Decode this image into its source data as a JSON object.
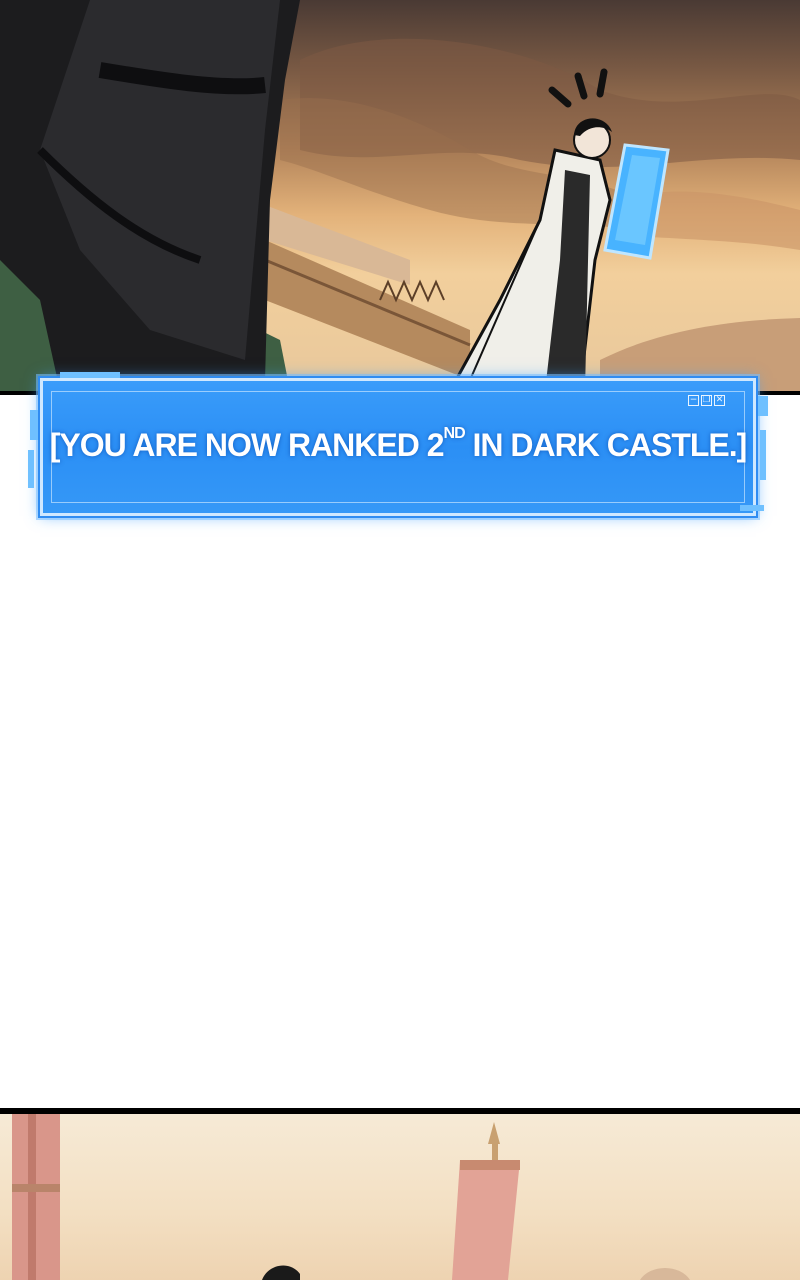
{
  "panels": {
    "top": {
      "description_icon": "sunset-scene-icon"
    },
    "bottom": {
      "description_icon": "banner-scene-icon"
    }
  },
  "system_message": {
    "prefix": "[YOU ARE NOW RANKED 2",
    "superscript": "ND",
    "suffix": " IN DARK CASTLE.]",
    "window_controls": [
      "−",
      "❐",
      "✕"
    ]
  },
  "colors": {
    "box_blue": "#2b8ff5",
    "box_border": "#cfe8ff",
    "panel_border": "#000000"
  }
}
